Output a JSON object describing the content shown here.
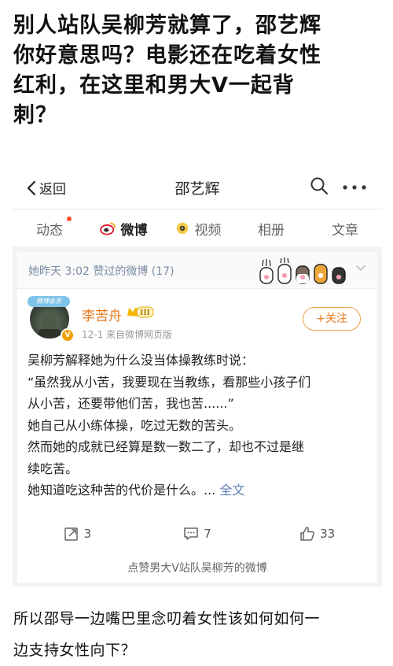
{
  "headline": {
    "line1": "别人站队吴柳芳就算了，邵艺辉",
    "line2": "你好意思吗？电影还在吃着女性",
    "line3": "红利，在这里和男大V一起背",
    "line4": "刺？"
  },
  "navbar": {
    "back_label": "返回",
    "title": "邵艺辉",
    "search_icon": "search-icon",
    "more_icon": "more-dots-icon"
  },
  "tabs": [
    {
      "label": "动态",
      "has_dot": true
    },
    {
      "label": "微博",
      "icon": "weibo-icon",
      "active": true
    },
    {
      "label": "视频",
      "icon": "video-icon"
    },
    {
      "label": "相册"
    },
    {
      "label": "文章"
    }
  ],
  "liked_header": {
    "text": "她昨天 3:02 赞过的微博 (17)"
  },
  "post": {
    "author": "李苦舟",
    "vip_level": "III",
    "avatar_badge": "微博会员",
    "meta": "12-1  来自微博网页版",
    "follow_label": "+关注",
    "lines": [
      "吴柳芳解释她为什么没当体操教练时说：",
      "“虽然我从小苦，我要现在当教练，看那些小孩子们",
      "从小苦，还要带他们苦，我也苦......”",
      "她自己从小练体操，吃过无数的苦头。",
      "然而她的成就已经算是数一数二了，却也不过是继",
      "续吃苦。",
      "她知道吃这种苦的代价是什么。..."
    ],
    "full_text_link": "全文",
    "reposts": "3",
    "comments": "7",
    "likes": "33"
  },
  "caption": "点赞男大V站队吴柳芳的微博",
  "footer": {
    "line1": "所以邵导一边嘴巴里念叨着女性该如何如何一",
    "line2": "边支持女性向下？"
  },
  "colors": {
    "accent_orange": "#e87a1a",
    "link_blue": "#5b7fb6",
    "meta_gray": "#999999",
    "liked_text": "#7a8ba3",
    "weibo_red": "#e6162d"
  }
}
